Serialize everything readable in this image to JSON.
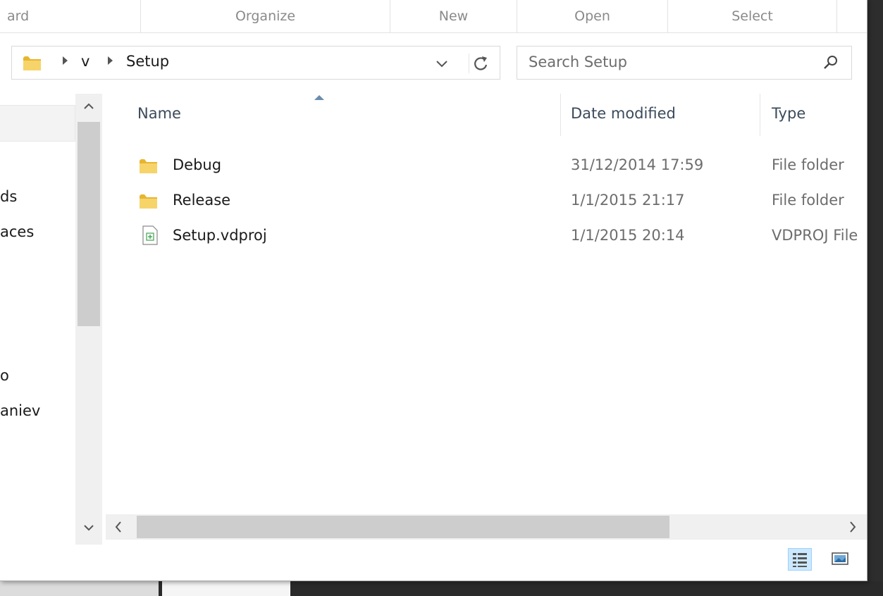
{
  "ribbon": {
    "groups": [
      {
        "label": "ard"
      },
      {
        "label": "Organize"
      },
      {
        "label": "New"
      },
      {
        "label": "Open"
      },
      {
        "label": "Select"
      }
    ]
  },
  "address": {
    "crumbs": [
      "v",
      "Setup"
    ],
    "dropdown_icon": "chevron-down-icon",
    "refresh_icon": "refresh-icon"
  },
  "search": {
    "placeholder": "Search Setup",
    "icon": "search-icon"
  },
  "navpane": {
    "items": [
      {
        "label": "ds"
      },
      {
        "label": "aces"
      },
      {
        "label": "o"
      },
      {
        "label": "aniev"
      }
    ]
  },
  "columns": {
    "name": "Name",
    "date": "Date modified",
    "type": "Type"
  },
  "files": [
    {
      "name": "Debug",
      "date": "31/12/2014 17:59",
      "type": "File folder",
      "icon": "folder-icon"
    },
    {
      "name": "Release",
      "date": "1/1/2015 21:17",
      "type": "File folder",
      "icon": "folder-icon"
    },
    {
      "name": "Setup.vdproj",
      "date": "1/1/2015 20:14",
      "type": "VDPROJ File",
      "icon": "file-icon"
    }
  ],
  "view_modes": {
    "details_icon": "details-view-icon",
    "thumbnail_icon": "large-icons-view-icon",
    "active": "details"
  },
  "colors": {
    "accent": "#cce8ff",
    "accent_border": "#99d1ff",
    "folder": "#e8b52f"
  }
}
